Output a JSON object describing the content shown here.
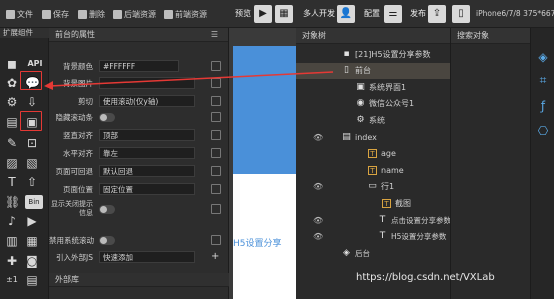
{
  "toolbar": {
    "file": "文件",
    "save": "保存",
    "delete": "删除",
    "backend_assets": "后端资源",
    "frontend_assets": "前端资源",
    "preview": "预览",
    "multi_dev": "多人开发",
    "config": "配置",
    "publish": "发布",
    "device": "iPhone6/7/8 375*667"
  },
  "left_strip": {
    "header": "扩展组件",
    "api_label": "API",
    "text_label": "T",
    "bin_label": "Bin",
    "plusminus_label": "±1"
  },
  "props": {
    "header": "前台的属性",
    "rows": [
      {
        "label": "背景颜色",
        "value": "#FFFFFF"
      },
      {
        "label": "背景图片",
        "value": ""
      },
      {
        "label": "剪切",
        "value": "使用滚动(仅y轴)"
      },
      {
        "label": "隐藏滚动条",
        "value": ""
      },
      {
        "label": "竖直对齐",
        "value": "顶部"
      },
      {
        "label": "水平对齐",
        "value": "靠左"
      },
      {
        "label": "页面可回退",
        "value": "默认回退"
      },
      {
        "label": "页面位置",
        "value": "固定位置"
      },
      {
        "label": "显示关闭提示信息",
        "value": ""
      },
      {
        "label": "禁用系统滚动",
        "value": ""
      },
      {
        "label": "引入外部JS",
        "value": "快速添加"
      }
    ],
    "external_lib": "外部库"
  },
  "canvas": {
    "text": "H5设置分享"
  },
  "tree": {
    "tab_objects": "对象树",
    "tab_search": "搜索对象",
    "rows": [
      {
        "text": "[21]H5设置分享参数",
        "icon": "app-icon"
      },
      {
        "text": "前台",
        "icon": "phone-icon"
      },
      {
        "text": "系统界面1",
        "icon": "system-ui-icon"
      },
      {
        "text": "微信公众号1",
        "icon": "wechat-icon"
      },
      {
        "text": "系统",
        "icon": "gear-icon"
      },
      {
        "text": "index",
        "icon": "page-icon"
      },
      {
        "text": "age",
        "icon": "text-icon"
      },
      {
        "text": "name",
        "icon": "text-icon"
      },
      {
        "text": "行1",
        "icon": "row-icon"
      },
      {
        "text": "截图",
        "icon": "text-icon"
      },
      {
        "text": "点击设置分享参数",
        "icon": "label-icon"
      },
      {
        "text": "H5设置分享参数",
        "icon": "label-icon"
      },
      {
        "text": "后台",
        "icon": "backend-icon"
      }
    ]
  },
  "watermark": "https://blog.csdn.net/VXLab",
  "colors": {
    "accent": "#e53935",
    "highlight": "#4a90d9"
  }
}
